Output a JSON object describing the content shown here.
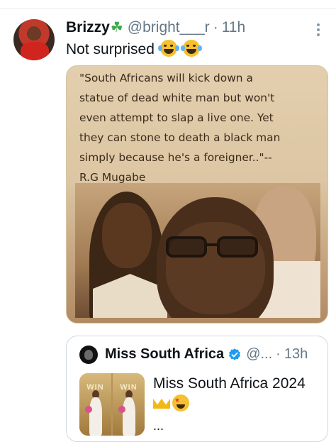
{
  "tweet": {
    "display_name": "Brizzy",
    "name_emoji": "☘",
    "handle": "@bright___r",
    "separator": "·",
    "time": "11h",
    "text": "Not surprised",
    "text_emoji": "face-with-tears-of-joy-icon",
    "more_icon": "more-options-icon"
  },
  "media": {
    "quote": "\"South Africans will kick down a\nstatue of dead white man but won't\neven attempt to slap a live one. Yet\nthey can stone to death a black man\nsimply because he's a foreigner..\"--\nR.G Mugabe"
  },
  "quoted_tweet": {
    "display_name": "Miss South Africa",
    "verified_icon": "verified-badge-icon",
    "handle": "@...",
    "separator": "·",
    "time": "13h",
    "text": "Miss South Africa 2024",
    "emojis": [
      "crown-icon",
      "star-struck-icon"
    ],
    "thumb_watermark": "WIN",
    "ellipsis": "..."
  },
  "colors": {
    "text_primary": "#0f1419",
    "text_secondary": "#657786",
    "verified": "#1d9bf0",
    "border": "#cfd9de"
  }
}
